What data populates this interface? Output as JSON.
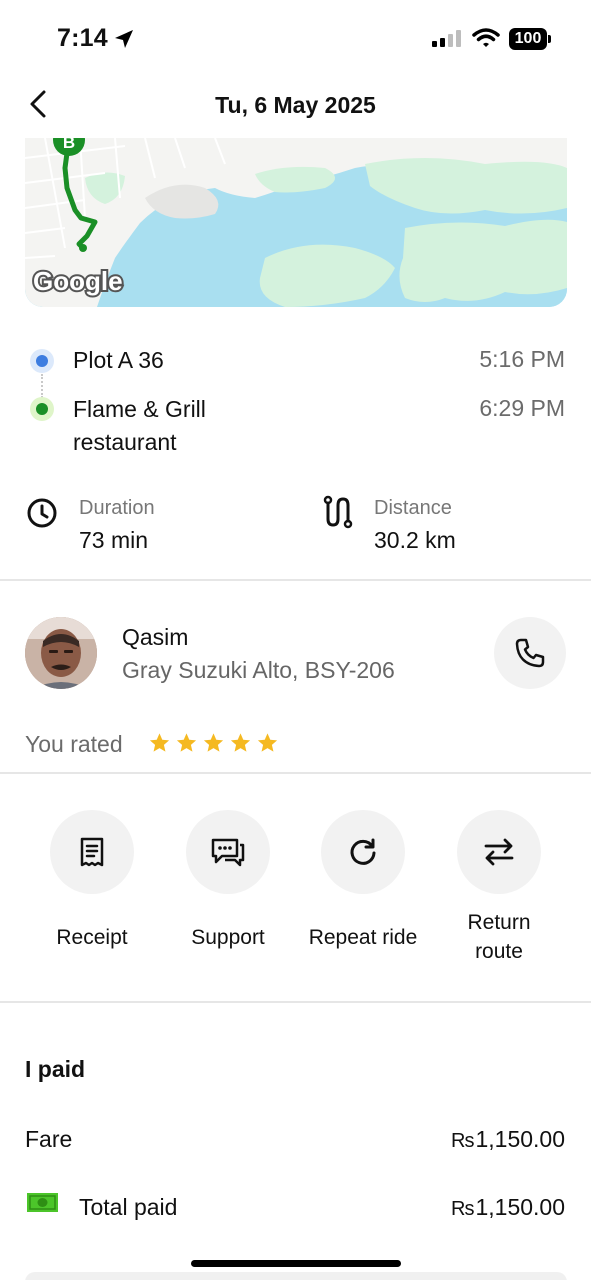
{
  "status_bar": {
    "time": "7:14",
    "battery": "100"
  },
  "header": {
    "title": "Tu, 6 May 2025"
  },
  "map": {
    "marker_label": "B",
    "attribution": "Google",
    "route_color": "#1a8f26",
    "water_color": "#a9dff0",
    "land_color": "#d4f2dd"
  },
  "route": {
    "pickup": {
      "name": "Plot A 36",
      "time": "5:16 PM",
      "color": "#3d7de0"
    },
    "dropoff": {
      "name_line1": "Flame & Grill",
      "name_line2": "restaurant",
      "time": "6:29 PM",
      "color": "#1a8f26"
    }
  },
  "stats": {
    "duration": {
      "label": "Duration",
      "value": "73 min",
      "icon": "clock-icon"
    },
    "distance": {
      "label": "Distance",
      "value": "30.2 km",
      "icon": "route-icon"
    }
  },
  "driver": {
    "name": "Qasim",
    "car": "Gray Suzuki Alto, BSY-206",
    "rated_label": "You rated",
    "rating": 5,
    "star_color": "#f5b921"
  },
  "actions": [
    {
      "label": "Receipt",
      "icon": "receipt-icon"
    },
    {
      "label": "Support",
      "icon": "chat-icon"
    },
    {
      "label": "Repeat ride",
      "icon": "refresh-icon"
    },
    {
      "label_line1": "Return",
      "label_line2": "route",
      "icon": "swap-icon"
    }
  ],
  "payment": {
    "title": "I paid",
    "fare_label": "Fare",
    "currency": "Rs",
    "fare_amount": "1,150.00",
    "total_label": "Total paid",
    "total_amount": "1,150.00",
    "cash_color": "#4cc52a"
  }
}
